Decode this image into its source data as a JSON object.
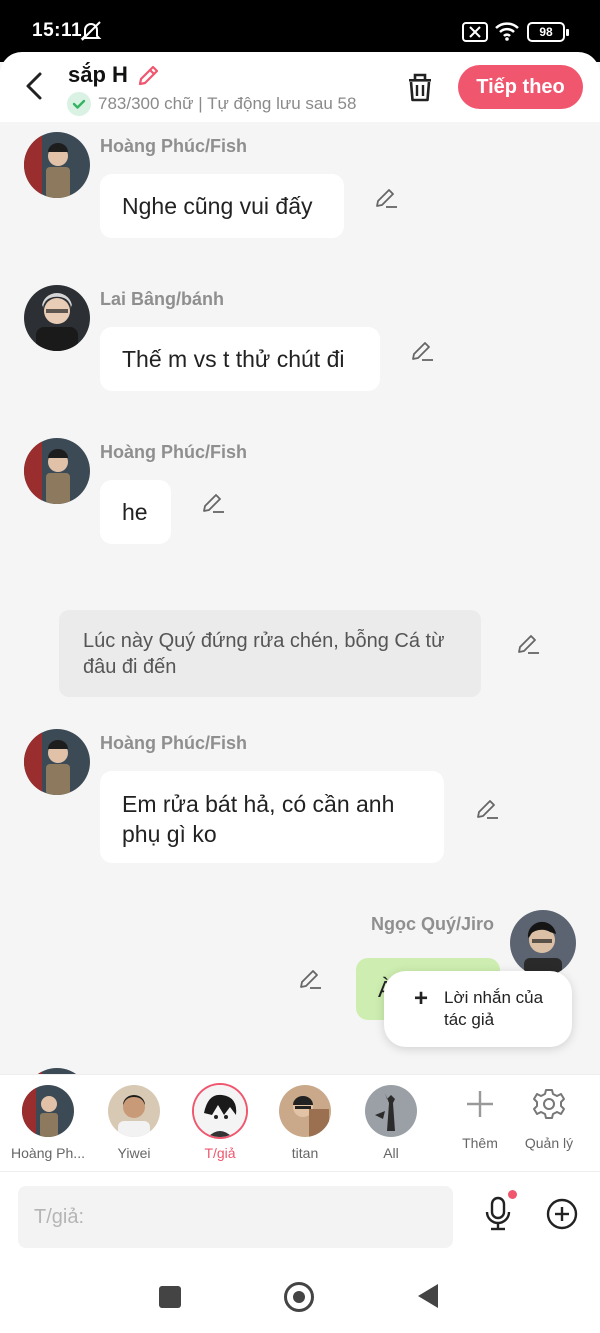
{
  "status_bar": {
    "time": "15:11",
    "battery": "98"
  },
  "header": {
    "title": "sắp H",
    "subtitle": "783/300 chữ | Tự động lưu sau 58",
    "next_label": "Tiếp theo"
  },
  "messages": [
    {
      "sender": "Hoàng Phúc/Fish",
      "text": "Nghe cũng vui đấy"
    },
    {
      "sender": "Lai Bâng/bánh",
      "text": "Thế m vs t thử chút đi"
    },
    {
      "sender": "Hoàng Phúc/Fish",
      "text": "he"
    },
    {
      "narration": "Lúc này Quý đứng rửa chén, bỗng Cá từ đâu đi đến"
    },
    {
      "sender": "Hoàng Phúc/Fish",
      "text": "Em rửa bát hả, có cần anh phụ gì ko"
    },
    {
      "sender": "Ngọc Quý/Jiro",
      "text": "À"
    }
  ],
  "author_note_popup": {
    "label": "Lời nhắn của tác giả"
  },
  "characters": [
    {
      "name": "Hoàng Ph..."
    },
    {
      "name": "Yiwei"
    },
    {
      "name": "T/giả"
    },
    {
      "name": "titan"
    },
    {
      "name": "All"
    }
  ],
  "tools": {
    "add_label": "Thêm",
    "manage_label": "Quản lý"
  },
  "input": {
    "placeholder": "T/giả:"
  },
  "colors": {
    "accent": "#f0566e",
    "my_bubble": "#cdeeb0",
    "narration_bg": "#ebebeb"
  }
}
